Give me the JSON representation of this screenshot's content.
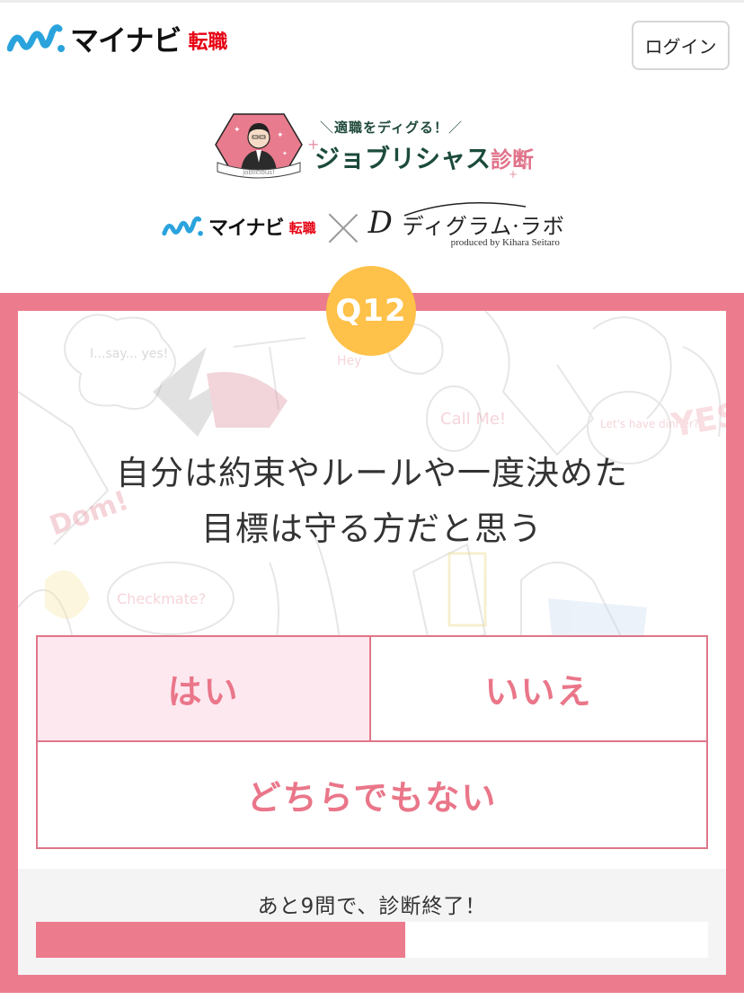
{
  "header": {
    "brand_kana": "マイナビ",
    "brand_sub": "転職",
    "login_label": "ログイン"
  },
  "campaign": {
    "catch": "適職をディグる！",
    "title_main": "ジョブリシャス",
    "title_accent": "診断",
    "portrait_caption": "joblicious!"
  },
  "collab": {
    "brand_kana": "マイナビ",
    "brand_sub": "転職",
    "cross": "×",
    "partner_initial": "D",
    "partner_name": "ディグラム·ラボ",
    "partner_sub": "produced by Kihara Seitaro"
  },
  "quiz": {
    "question_number": "Q12",
    "question_line1": "自分は約束やルールや一度決めた",
    "question_line2": "目標は守る方だと思う",
    "answers": [
      {
        "label": "はい",
        "selected": true
      },
      {
        "label": "いいえ",
        "selected": false
      },
      {
        "label": "どちらでもない",
        "selected": false
      }
    ],
    "background_words": [
      "I...say... yes!",
      "Hey",
      "Call Me!",
      "Let's have dinner?",
      "YES",
      "Dom!",
      "Checkmate?"
    ]
  },
  "progress": {
    "remaining_text": "あと9問で、診断終了！",
    "percent": 55,
    "fill_color": "#ec7b8d"
  },
  "colors": {
    "frame": "#ec7b8d",
    "badge": "#fec149",
    "answer_text": "#ea7689",
    "selected_bg": "#fde8f0",
    "brand_blue": "#2aa3dd",
    "brand_red": "#e60012",
    "campaign_green": "#1c4b3b"
  }
}
